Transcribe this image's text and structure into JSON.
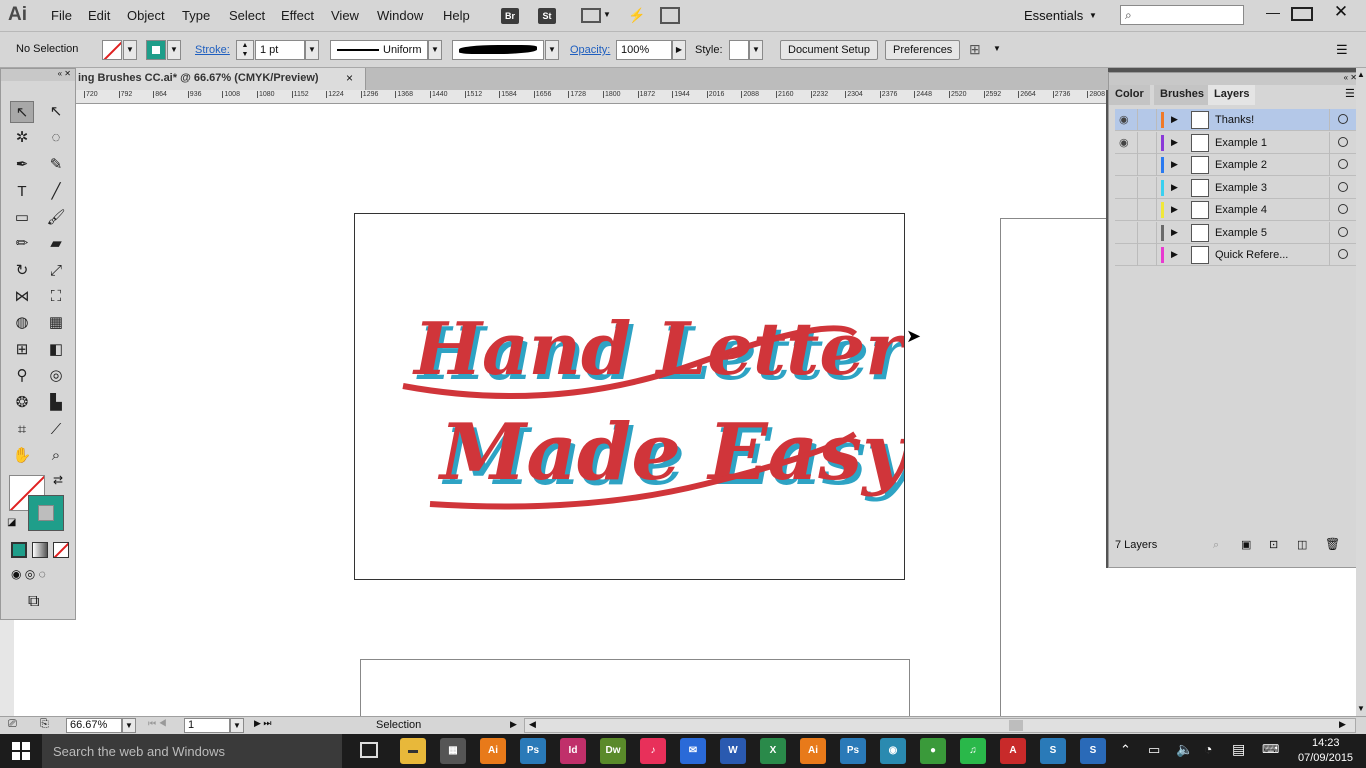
{
  "app": {
    "logo": "Ai",
    "workspace": "Essentials"
  },
  "menu": [
    "File",
    "Edit",
    "Object",
    "Type",
    "Select",
    "Effect",
    "View",
    "Window",
    "Help"
  ],
  "menu_icons": {
    "bridge": "Br",
    "stock": "St"
  },
  "control": {
    "selection_state": "No Selection",
    "stroke_label": "Stroke:",
    "stroke_weight": "1 pt",
    "profile_label": "Uniform",
    "opacity_label": "Opacity:",
    "opacity_value": "100%",
    "style_label": "Style:",
    "doc_setup": "Document Setup",
    "preferences": "Preferences"
  },
  "document": {
    "tab_title": "ing Brushes CC.ai* @ 66.67% (CMYK/Preview)",
    "close": "×"
  },
  "ruler_ticks": [
    "720",
    "792",
    "864",
    "936",
    "1008",
    "1080",
    "1152",
    "1224",
    "1296",
    "1368",
    "1440",
    "1512",
    "1584",
    "1656",
    "1728",
    "1800",
    "1872",
    "1944",
    "2016",
    "2088",
    "2160",
    "2232",
    "2304",
    "2376",
    "2448",
    "2520",
    "2592",
    "2664",
    "2736",
    "2808"
  ],
  "artwork": {
    "line1": "Hand Lettering",
    "line2": "Made Easy!",
    "red": "#d0353a",
    "blue": "#2ea3c4"
  },
  "panel": {
    "tabs": [
      "Color",
      "Brushes",
      "Layers"
    ],
    "active_tab": "Layers",
    "layers": [
      {
        "name": "Thanks!",
        "color": "#f07a2a",
        "visible": true,
        "selected": true
      },
      {
        "name": "Example 1",
        "color": "#8a3ad8",
        "visible": true,
        "selected": false
      },
      {
        "name": "Example 2",
        "color": "#2a7af0",
        "visible": false,
        "selected": false
      },
      {
        "name": "Example 3",
        "color": "#3ad0f0",
        "visible": false,
        "selected": false
      },
      {
        "name": "Example 4",
        "color": "#f0e83a",
        "visible": false,
        "selected": false
      },
      {
        "name": "Example 5",
        "color": "#6a6a6a",
        "visible": false,
        "selected": false
      },
      {
        "name": "Quick Refere...",
        "color": "#e83ad0",
        "visible": false,
        "selected": false
      }
    ],
    "footer": "7 Layers"
  },
  "status": {
    "zoom": "66.67%",
    "page": "1",
    "tool": "Selection"
  },
  "taskbar": {
    "search_placeholder": "Search the web and Windows",
    "time": "14:23",
    "date": "07/09/2015",
    "apps": [
      {
        "label": "Ai",
        "color": "#e87a1a"
      },
      {
        "label": "Ps",
        "color": "#2a7ab8"
      },
      {
        "label": "Id",
        "color": "#c0306a"
      },
      {
        "label": "Dw",
        "color": "#5a8a2a"
      },
      {
        "label": "♪",
        "color": "#e8305a"
      },
      {
        "label": "✉",
        "color": "#2a6ad8"
      },
      {
        "label": "W",
        "color": "#2a5ab0"
      },
      {
        "label": "X",
        "color": "#2a8a4a"
      },
      {
        "label": "Ai",
        "color": "#e87a1a"
      },
      {
        "label": "Ps",
        "color": "#2a7ab8"
      },
      {
        "label": "◉",
        "color": "#2a8ab0"
      },
      {
        "label": "●",
        "color": "#3a9a3a"
      },
      {
        "label": "♫",
        "color": "#2ab84a"
      },
      {
        "label": "A",
        "color": "#c82a2a"
      },
      {
        "label": "S",
        "color": "#2a7ab8"
      },
      {
        "label": "S",
        "color": "#2a6ab8"
      }
    ]
  }
}
